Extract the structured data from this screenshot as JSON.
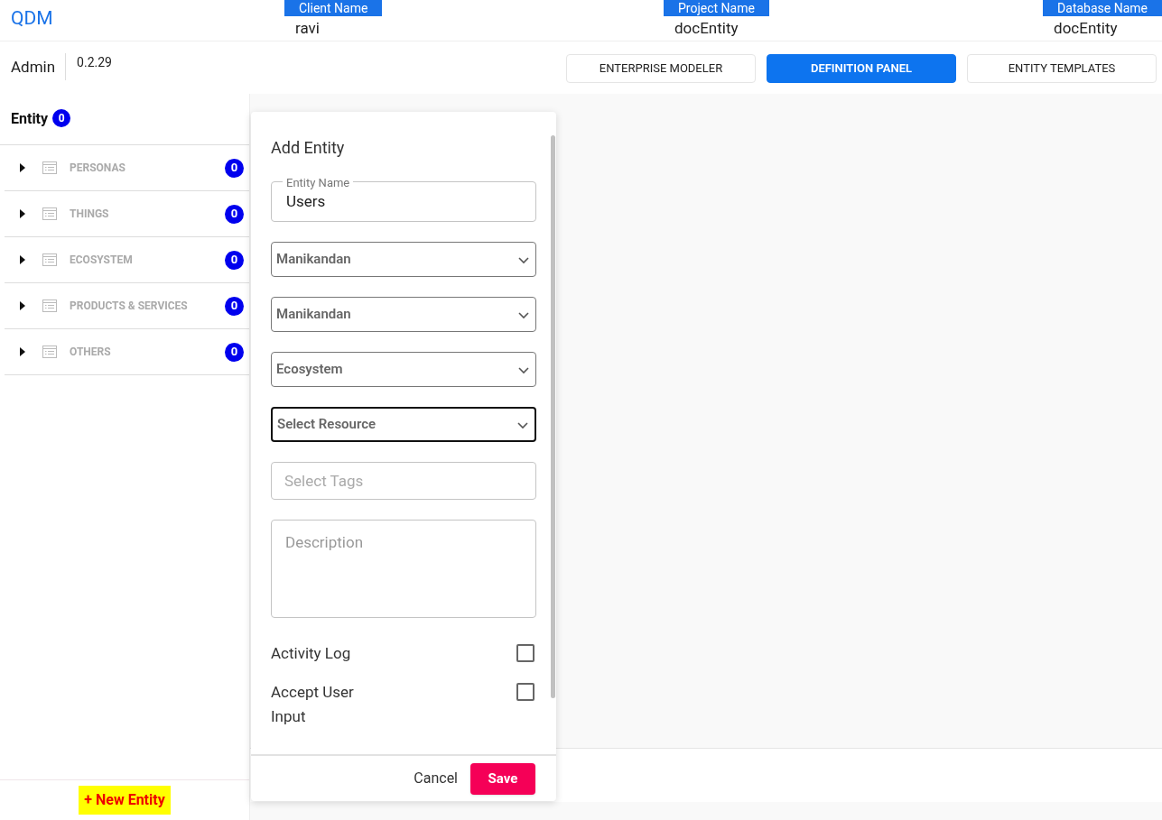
{
  "header": {
    "logo": "QDM",
    "info": [
      {
        "label": "Client Name",
        "value": "ravi"
      },
      {
        "label": "Project Name",
        "value": "docEntity"
      },
      {
        "label": "Database Name",
        "value": "docEntity"
      }
    ]
  },
  "subheader": {
    "role": "Admin",
    "version": "0.2.29",
    "tabs": [
      {
        "label": "ENTERPRISE MODELER",
        "selected": false
      },
      {
        "label": "DEFINITION PANEL",
        "selected": true
      },
      {
        "label": "ENTITY TEMPLATES",
        "selected": false
      }
    ]
  },
  "sidebar": {
    "title": "Entity",
    "count": "0",
    "items": [
      {
        "label": "PERSONAS",
        "count": "0"
      },
      {
        "label": "THINGS",
        "count": "0"
      },
      {
        "label": "ECOSYSTEM",
        "count": "0"
      },
      {
        "label": "PRODUCTS & SERVICES",
        "count": "0"
      },
      {
        "label": "OTHERS",
        "count": "0"
      }
    ],
    "new_button": "+ New Entity"
  },
  "dialog": {
    "title": "Add Entity",
    "fields": [
      {
        "kind": "text",
        "label": "Entity Name",
        "value": "Users"
      },
      {
        "kind": "select",
        "value": "Manikandan",
        "focused": false
      },
      {
        "kind": "select",
        "value": "Manikandan",
        "focused": false
      },
      {
        "kind": "select",
        "value": "Ecosystem",
        "focused": false
      },
      {
        "kind": "select",
        "value": "Select Resource",
        "focused": true
      },
      {
        "kind": "tags",
        "placeholder": "Select Tags"
      },
      {
        "kind": "textarea",
        "placeholder": "Description"
      }
    ],
    "checkboxes": [
      {
        "label": "Activity Log",
        "checked": false
      },
      {
        "label": "Accept User Input",
        "checked": false
      }
    ],
    "cancel": "Cancel",
    "save": "Save"
  }
}
